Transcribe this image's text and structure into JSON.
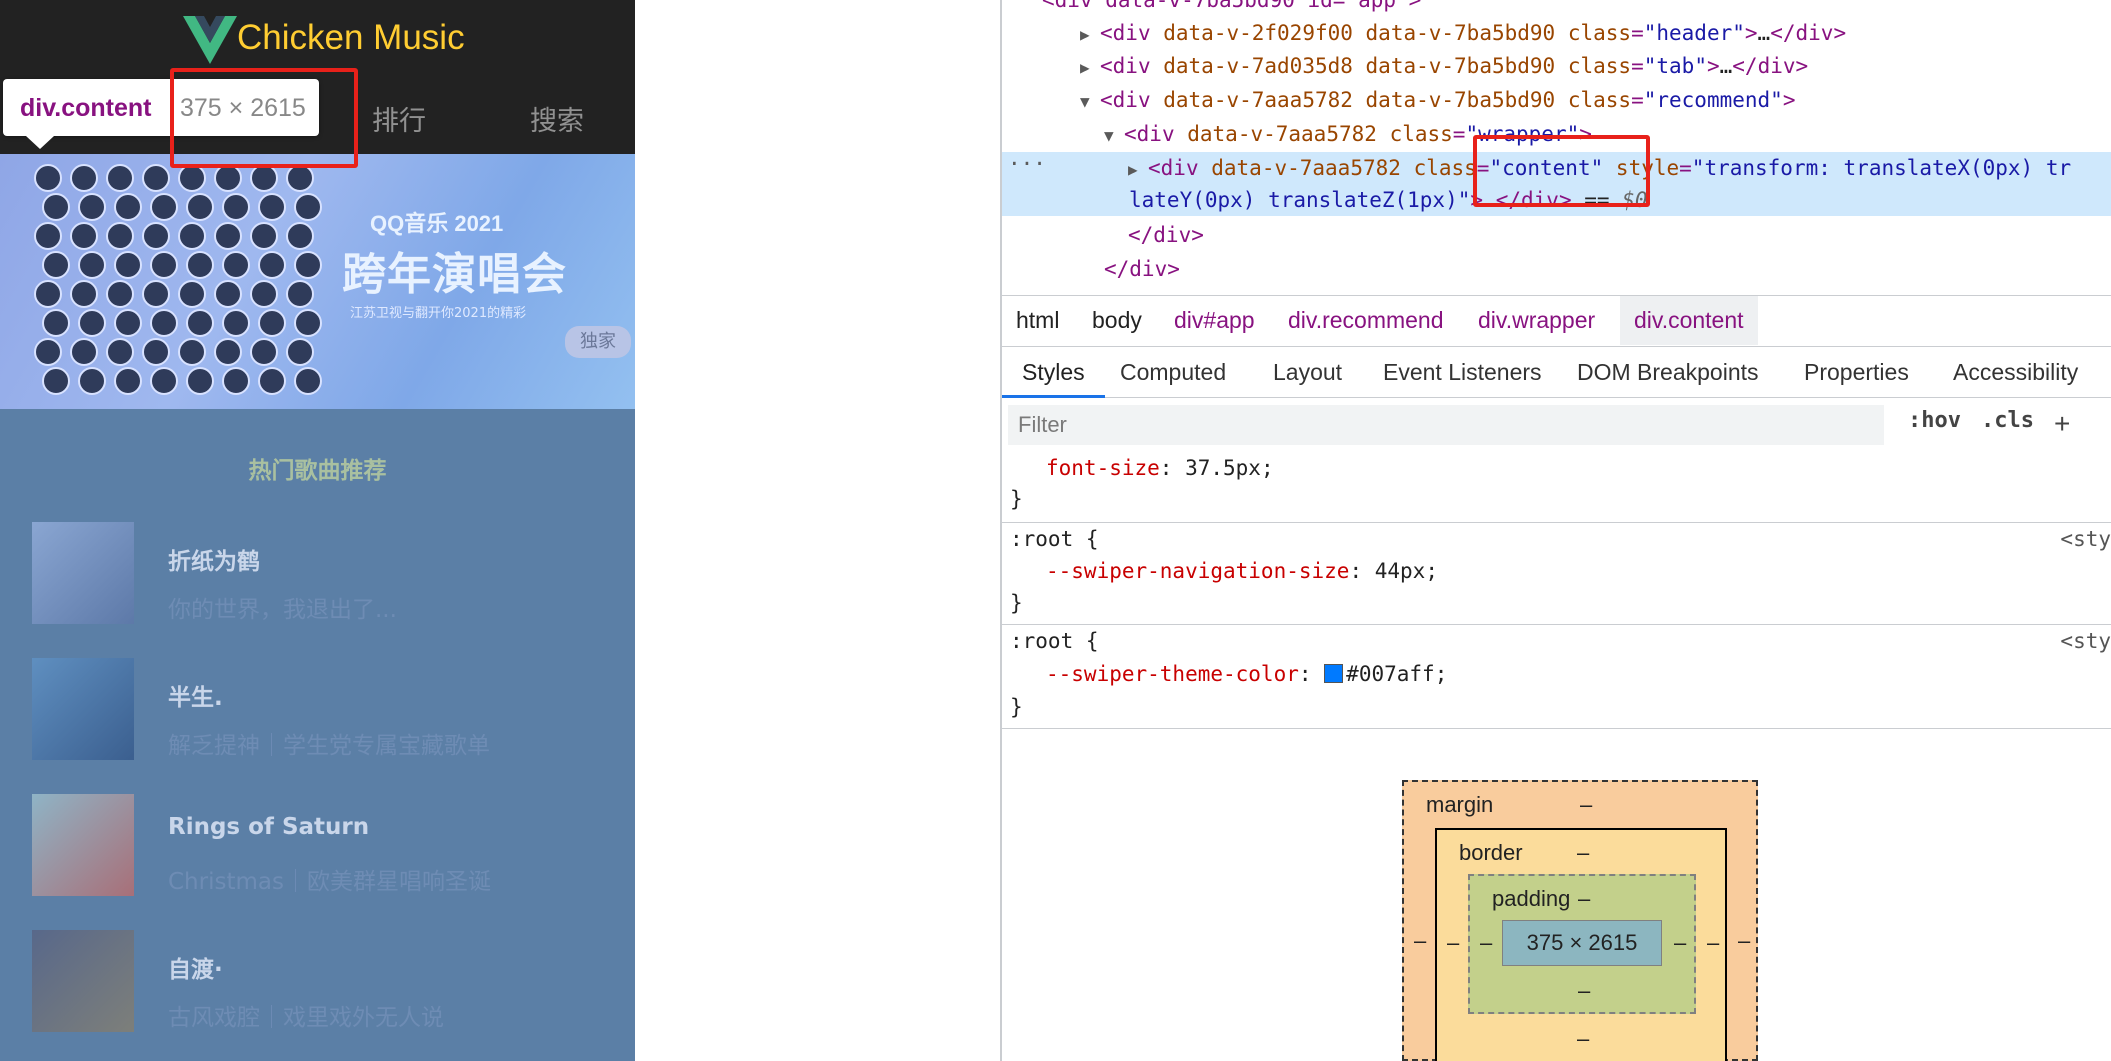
{
  "app": {
    "title": "Chicken Music",
    "tabs": [
      "排行",
      "搜索"
    ],
    "inspect_tooltip": {
      "name": "div.content",
      "size": "375 × 2615"
    },
    "banner": {
      "brand": "QQ音乐 2021",
      "title": "跨年演唱会",
      "subtitle": "江苏卫视与翻开你2021的精彩",
      "badge": "独家"
    },
    "list_title": "热门歌曲推荐",
    "songs": [
      {
        "name": "折纸为鹤",
        "desc": "你的世界，我退出了..."
      },
      {
        "name": "半生.",
        "desc": "解乏提神｜学生党专属宝藏歌单"
      },
      {
        "name": "Rings of Saturn",
        "desc": "Christmas｜欧美群星唱响圣诞"
      },
      {
        "name": "自渡·",
        "desc": "古风戏腔｜戏里戏外无人说"
      }
    ]
  },
  "devtools": {
    "dom": {
      "top_line": "<div data-v-7ba5bd90 id=\"app\">",
      "header": {
        "tag": "div",
        "attrs": "data-v-2f029f00 data-v-7ba5bd90",
        "class": "header",
        "collapsed": "…"
      },
      "tab": {
        "tag": "div",
        "attrs": "data-v-7ad035d8 data-v-7ba5bd90",
        "class": "tab",
        "collapsed": "…"
      },
      "recommend": {
        "tag": "div",
        "attrs": "data-v-7aaa5782 data-v-7ba5bd90",
        "class": "recommend"
      },
      "wrapper": {
        "tag": "div",
        "attrs": "data-v-7aaa5782",
        "class": "wrapper"
      },
      "content": {
        "tag": "div",
        "attrs": "data-v-7aaa5782",
        "class": "content",
        "style_part1": "transform: translateX(0px) tr",
        "style_part2": "lateY(0px) translateZ(1px)",
        "collapsed": "…",
        "ref": "$0"
      },
      "close_wrapper": "</div>",
      "close_recommend": "</div>",
      "ellipsis_indicator": "···"
    },
    "breadcrumbs": [
      "html",
      "body",
      "div#app",
      "div.recommend",
      "div.wrapper",
      "div.content"
    ],
    "subtabs": [
      "Styles",
      "Computed",
      "Layout",
      "Event Listeners",
      "DOM Breakpoints",
      "Properties",
      "Accessibility"
    ],
    "active_subtab": "Styles",
    "filter": {
      "placeholder": "Filter",
      "hov": ":hov",
      "cls": ".cls"
    },
    "rules": [
      {
        "selector": "",
        "property": "font-size",
        "value": "37.5px",
        "source": ""
      },
      {
        "selector": ":root",
        "property": "--swiper-navigation-size",
        "value": "44px",
        "source": "<sty"
      },
      {
        "selector": ":root",
        "property": "--swiper-theme-color",
        "value": "#007aff",
        "source": "<sty"
      }
    ],
    "box_model": {
      "margin_label": "margin",
      "border_label": "border",
      "padding_label": "padding",
      "content": "375 × 2615",
      "dash": "–"
    }
  },
  "colors": {
    "app_bg": "#222222",
    "title_yellow": "#ffcd32",
    "highlight_blue": "#5b7fa6",
    "devtools_tag": "#881280",
    "devtools_attr": "#994500",
    "devtools_value": "#1a1aa6",
    "selected_row": "#cfe8fc",
    "annotation_red": "#e8211a",
    "swiper_theme": "#007aff"
  }
}
